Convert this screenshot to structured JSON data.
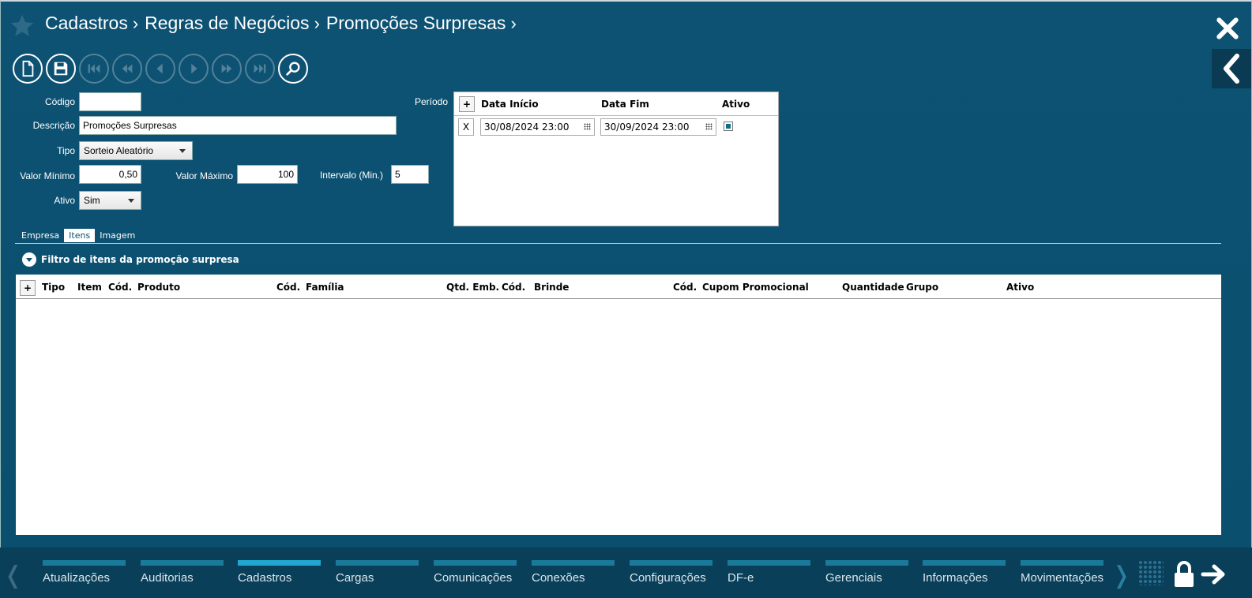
{
  "header": {
    "breadcrumb": [
      "Cadastros",
      "Regras de Negócios",
      "Promoções Surpresas"
    ]
  },
  "form": {
    "codigo_label": "Código",
    "codigo_value": "",
    "descricao_label": "Descrição",
    "descricao_value": "Promoções Surpresas",
    "tipo_label": "Tipo",
    "tipo_value": "Sorteio Aleatório",
    "valor_minimo_label": "Valor Mínimo",
    "valor_minimo_value": "0,50",
    "valor_maximo_label": "Valor Máximo",
    "valor_maximo_value": "100",
    "intervalo_label": "Intervalo (Min.)",
    "intervalo_value": "5",
    "ativo_label": "Ativo",
    "ativo_value": "Sim",
    "periodo_label": "Período"
  },
  "periodo_grid": {
    "add": "+",
    "headers": [
      "Data Início",
      "Data Fim",
      "Ativo"
    ],
    "rows": [
      {
        "remove": "X",
        "inicio": "30/08/2024 23:00",
        "fim": "30/09/2024 23:00",
        "ativo": true
      }
    ]
  },
  "tabs": [
    "Empresa",
    "Itens",
    "Imagem"
  ],
  "active_tab": "Itens",
  "filter_label": "Filtro de itens da promoção surpresa",
  "items_grid": {
    "add": "+",
    "headers": [
      "Tipo",
      "Item",
      "Cód.",
      "Produto",
      "Cód.",
      "Família",
      "Qtd. Emb.",
      "Cód.",
      "Brinde",
      "Cód.",
      "Cupom Promocional",
      "Quantidade",
      "Grupo",
      "Ativo"
    ]
  },
  "bottom_nav": [
    "Atualizações",
    "Auditorias",
    "Cadastros",
    "Cargas",
    "Comunicações",
    "Conexões",
    "Configurações",
    "DF-e",
    "Gerenciais",
    "Informações",
    "Movimentações"
  ],
  "bottom_active": "Cadastros",
  "colors": {
    "background": "#0d5273",
    "bottom_bar": "#0a3f5a",
    "nav_bar": "#1b7a99",
    "nav_active": "#21a7cf"
  }
}
